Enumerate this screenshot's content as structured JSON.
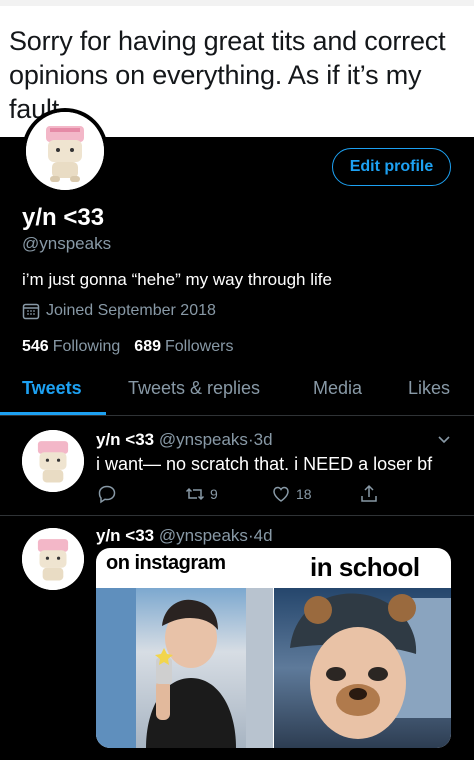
{
  "meme": {
    "text": "Sorry for having great tits and correct opinions on everything. As if it’s my fault"
  },
  "profile": {
    "edit_label": "Edit profile",
    "display_name": "y/n <33",
    "handle": "@ynspeaks",
    "bio": "i’m just gonna “hehe” my way through life",
    "joined": "Joined September 2018",
    "following_count": "546",
    "following_label": "Following",
    "followers_count": "689",
    "followers_label": "Followers"
  },
  "tabs": [
    {
      "label": "Tweets",
      "active": true
    },
    {
      "label": "Tweets & replies",
      "active": false
    },
    {
      "label": "Media",
      "active": false
    },
    {
      "label": "Likes",
      "active": false
    }
  ],
  "tweets": [
    {
      "name": "y/n <33",
      "handle": "@ynspeaks",
      "sep": "·",
      "time": "3d",
      "text": "i want— no scratch that. i NEED a loser bf",
      "retweets": "9",
      "likes": "18"
    },
    {
      "name": "y/n <33",
      "handle": "@ynspeaks",
      "sep": "·",
      "time": "4d",
      "media": {
        "left_caption": "on instagram",
        "right_caption": "in school"
      }
    }
  ],
  "colors": {
    "accent": "#1da1f2",
    "muted": "#8899a6",
    "divider": "#2f3336",
    "background": "#000000"
  }
}
